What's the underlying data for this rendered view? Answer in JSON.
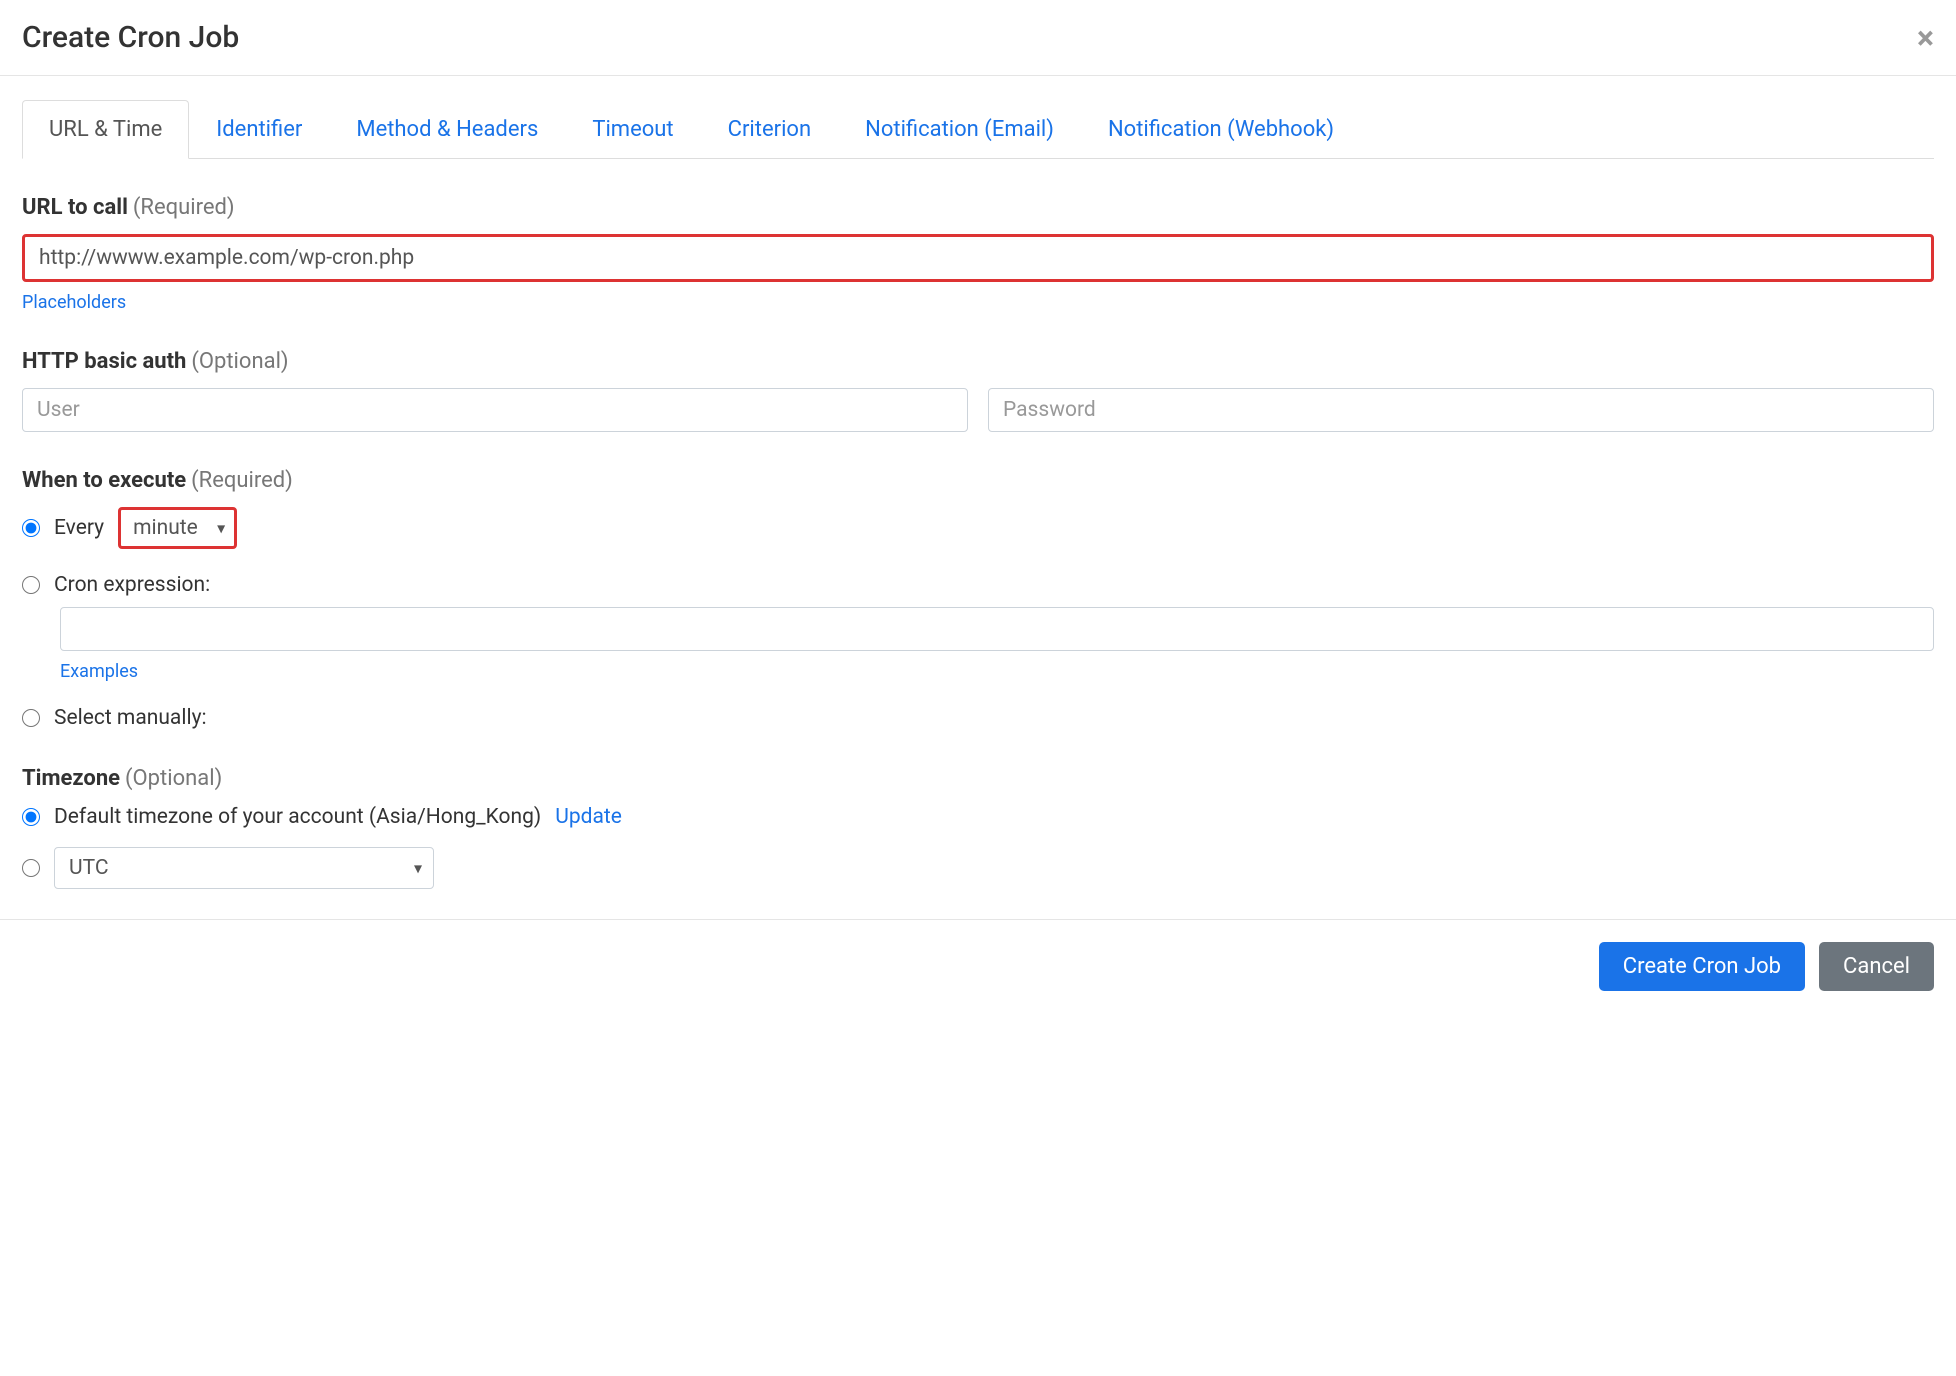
{
  "modal": {
    "title": "Create Cron Job"
  },
  "tabs": [
    {
      "label": "URL & Time"
    },
    {
      "label": "Identifier"
    },
    {
      "label": "Method & Headers"
    },
    {
      "label": "Timeout"
    },
    {
      "label": "Criterion"
    },
    {
      "label": "Notification (Email)"
    },
    {
      "label": "Notification (Webhook)"
    }
  ],
  "url_section": {
    "label": "URL to call",
    "hint": "(Required)",
    "value": "http://wwww.example.com/wp-cron.php",
    "placeholders_link": "Placeholders"
  },
  "auth_section": {
    "label": "HTTP basic auth",
    "hint": "(Optional)",
    "user_placeholder": "User",
    "password_placeholder": "Password"
  },
  "execute_section": {
    "label": "When to execute",
    "hint": "(Required)",
    "every_label": "Every",
    "every_select_value": "minute",
    "cron_label": "Cron expression:",
    "examples_link": "Examples",
    "manual_label": "Select manually:"
  },
  "timezone_section": {
    "label": "Timezone",
    "hint": "(Optional)",
    "default_label": "Default timezone of your account (Asia/Hong_Kong)",
    "update_link": "Update",
    "utc_value": "UTC"
  },
  "footer": {
    "create_label": "Create Cron Job",
    "cancel_label": "Cancel"
  }
}
